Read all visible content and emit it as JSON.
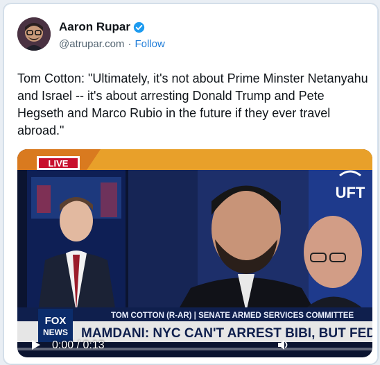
{
  "author": {
    "name": "Aaron Rupar",
    "handle": "@atrupar.com",
    "separator": "·",
    "follow_label": "Follow",
    "verified_color": "#1d9bf0"
  },
  "tweet": {
    "text": "Tom Cotton: \"Ultimately, it's not about Prime Minster Netanyahu and Israel -- it's about arresting Donald Trump and Pete Hegseth and Marco Rubio in the future if they ever travel abroad.\""
  },
  "video": {
    "live_label": "LIVE",
    "uft_label": "UFT",
    "fox_label": "FOX",
    "news_label": "NEWS",
    "lower_third": "TOM COTTON (R-AR) | SENATE ARMED SERVICES COMMITTEE",
    "chyron": "MAMDANI: NYC CAN'T ARREST BIBI, BUT FEDS SHOULD",
    "current_time": "0:00",
    "time_separator": " / ",
    "duration": "0:13",
    "progress": 0.0,
    "icons": [
      "play-icon",
      "volume-icon"
    ]
  }
}
